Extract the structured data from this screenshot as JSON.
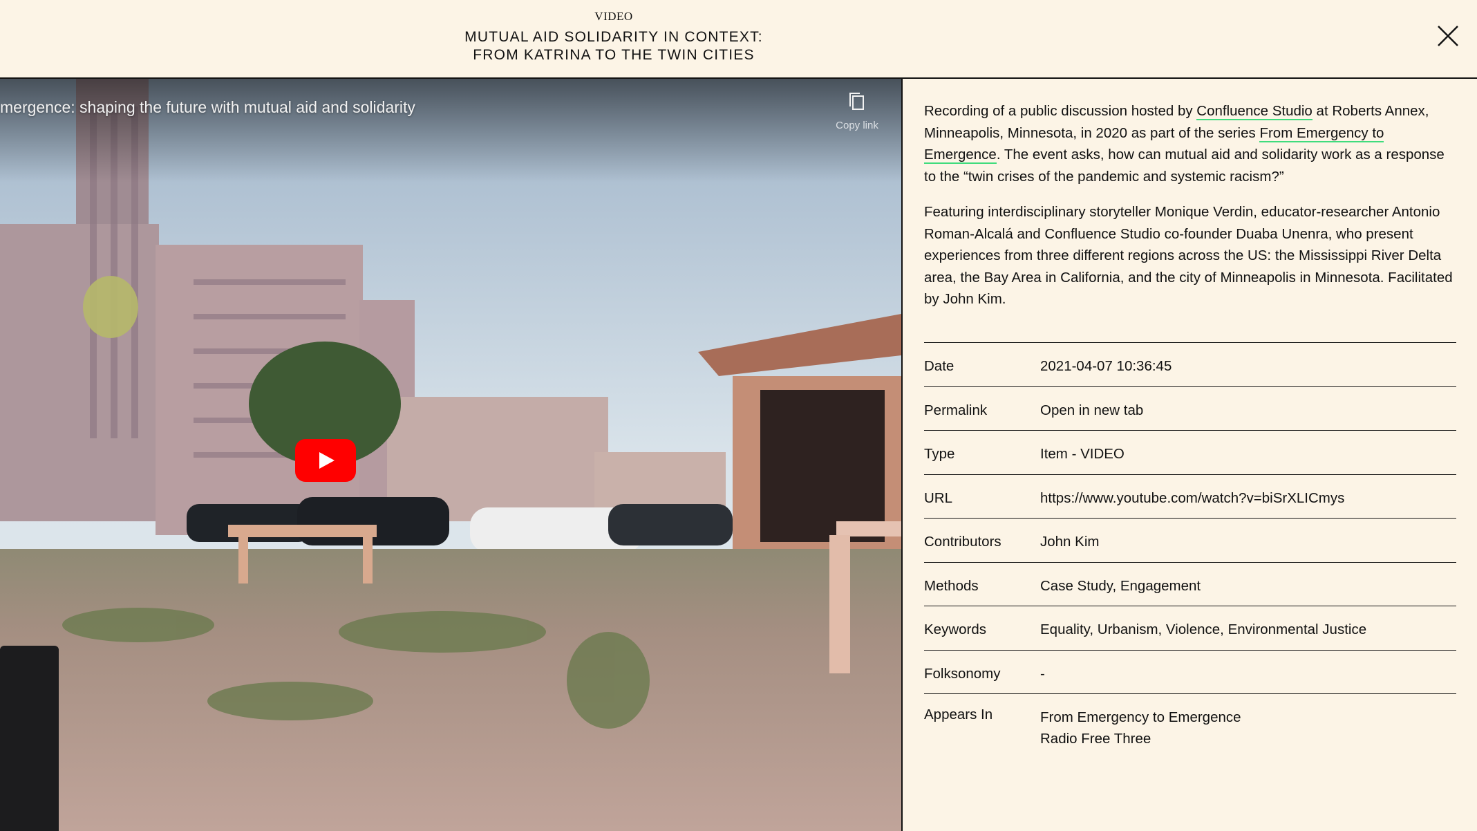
{
  "header": {
    "kicker": "VIDEO",
    "title_line1": "MUTUAL AID SOLIDARITY IN CONTEXT:",
    "title_line2": "FROM KATRINA TO THE TWIN CITIES",
    "close_icon": "close-icon"
  },
  "video": {
    "title": "mergence: shaping the future with mutual aid and solidarity",
    "copy_link_label": "Copy link",
    "play_icon": "play-icon",
    "copy_icon": "copy-icon"
  },
  "description": {
    "p1_a": "Recording of a public discussion hosted by ",
    "p1_link1": "Confluence Studio",
    "p1_b": " at Roberts Annex, Minneapolis, Minnesota, in 2020 as part of the series ",
    "p1_link2": "From Emergency to Emergence",
    "p1_c": ". The event asks, how can mutual aid and solidarity work as a response to the “twin crises of the pandemic and systemic racism?”",
    "p2": "Featuring interdisciplinary storyteller Monique Verdin, educator-researcher Antonio Roman-Alcalá and Confluence Studio co-founder Duaba Unenra, who present experiences from three different regions across the US: the Mississippi River Delta area, the Bay Area in California, and the city of Minneapolis in Minnesota. Facilitated by John Kim."
  },
  "meta": {
    "date_label": "Date",
    "date_value": "2021-04-07 10:36:45",
    "permalink_label": "Permalink",
    "permalink_value": "Open in new tab",
    "type_label": "Type",
    "type_value": "Item - VIDEO",
    "url_label": "URL",
    "url_value": "https://www.youtube.com/watch?v=biSrXLICmys",
    "contributors_label": "Contributors",
    "contributors_value": "John Kim",
    "methods_label": "Methods",
    "methods_value": "Case Study, Engagement",
    "keywords_label": "Keywords",
    "keywords_value": "Equality, Urbanism, Violence, Environmental Justice",
    "folksonomy_label": "Folksonomy",
    "folksonomy_value": "-",
    "appears_label": "Appears In",
    "appears_values": [
      "From Emergency to Emergence",
      "Radio Free Three"
    ]
  },
  "colors": {
    "background": "#fcf4e6",
    "link_underline": "#3fdc7d",
    "play_button": "#ff0000"
  }
}
